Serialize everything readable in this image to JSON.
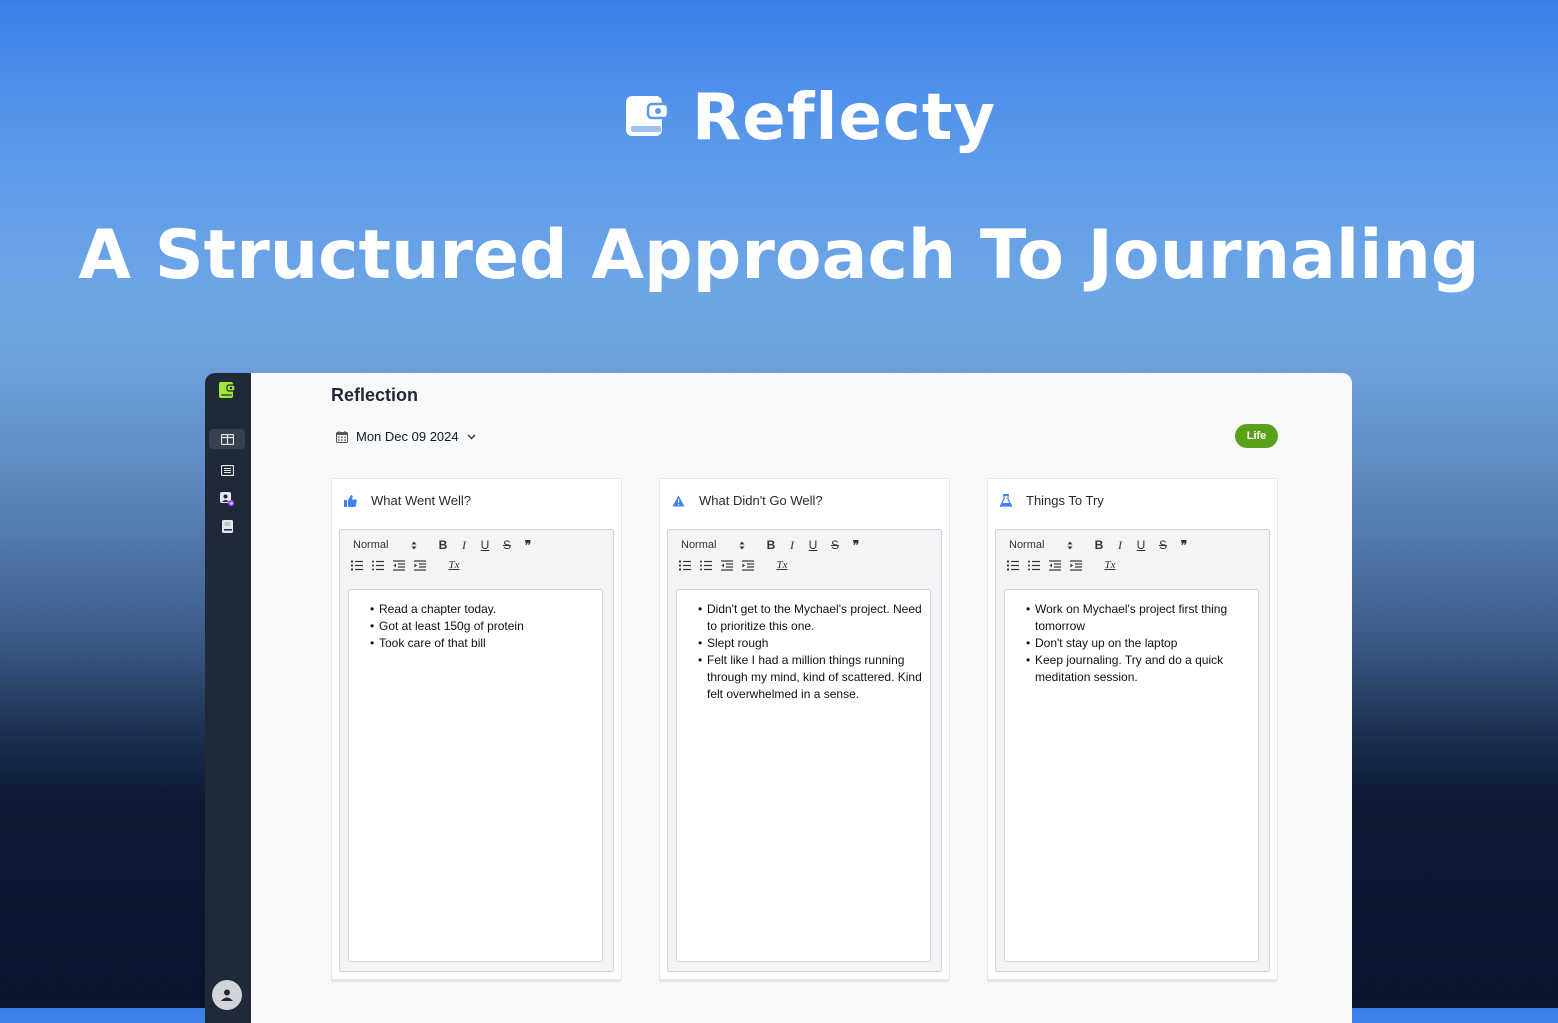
{
  "hero": {
    "brand": "Reflecty",
    "tagline": "A Structured Approach To Journaling"
  },
  "app": {
    "page_title": "Reflection",
    "date": "Mon Dec 09 2024",
    "tag": "Life",
    "colors": {
      "accent": "#58a21a",
      "sidebar": "#1f2937",
      "icon_blue": "#3b82f6",
      "logo_green": "#a3e635"
    },
    "sidebar_icons": [
      "logo-icon",
      "board-icon",
      "list-icon",
      "profile-icon",
      "book-icon",
      "user-icon"
    ],
    "toolbar": {
      "format_value": "Normal",
      "bold": "B",
      "italic": "I",
      "underline": "U",
      "strike": "S",
      "quote": "❞",
      "clear": "Tx"
    },
    "cards": [
      {
        "title": "What Went Well?",
        "icon": "thumbs-up-icon",
        "items": [
          "Read a chapter today.",
          "Got at least 150g of protein",
          "Took care of that bill"
        ]
      },
      {
        "title": "What Didn't Go Well?",
        "icon": "warning-icon",
        "items": [
          "Didn't get to the Mychael's project. Need to prioritize this one.",
          "Slept rough",
          "Felt like I had a million things running through my mind, kind of scattered. Kind felt overwhelmed in a sense."
        ]
      },
      {
        "title": "Things To Try",
        "icon": "flask-icon",
        "items": [
          "Work on Mychael's project first thing tomorrow",
          "Don't stay up on the laptop",
          "Keep journaling. Try and do a quick meditation session."
        ]
      }
    ]
  }
}
